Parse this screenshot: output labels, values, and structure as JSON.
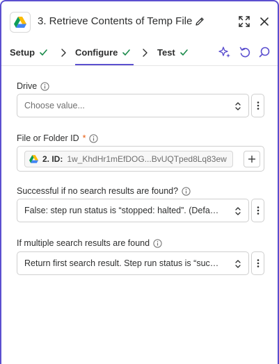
{
  "header": {
    "title": "3. Retrieve Contents of Temp File",
    "app_icon": "google-drive-icon",
    "edit_icon": "pencil-icon",
    "expand_icon": "expand-icon",
    "close_icon": "close-icon"
  },
  "tabs": [
    {
      "label": "Setup",
      "complete": true,
      "active": false
    },
    {
      "label": "Configure",
      "complete": true,
      "active": true
    },
    {
      "label": "Test",
      "complete": true,
      "active": false
    }
  ],
  "toolbar": {
    "icons": [
      "ai-sparkle-icon",
      "undo-icon",
      "search-icon"
    ]
  },
  "fields": {
    "drive": {
      "label": "Drive",
      "placeholder": "Choose value...",
      "value": ""
    },
    "file_id": {
      "label": "File or Folder ID",
      "required_mark": "*",
      "token_step": "2. ID:",
      "token_value": "1w_KhdHr1mEfDOG...BvUQTped8Lq83ew"
    },
    "no_results": {
      "label": "Successful if no search results are found?",
      "value": "False: step run status is “stopped: halted”. (Default)"
    },
    "multiple": {
      "label": "If multiple search results are found",
      "value": "Return first search result. Step run status is “success”."
    }
  },
  "colors": {
    "accent": "#5b4fcf",
    "check": "#1a8a4a",
    "required": "#e8590c"
  }
}
